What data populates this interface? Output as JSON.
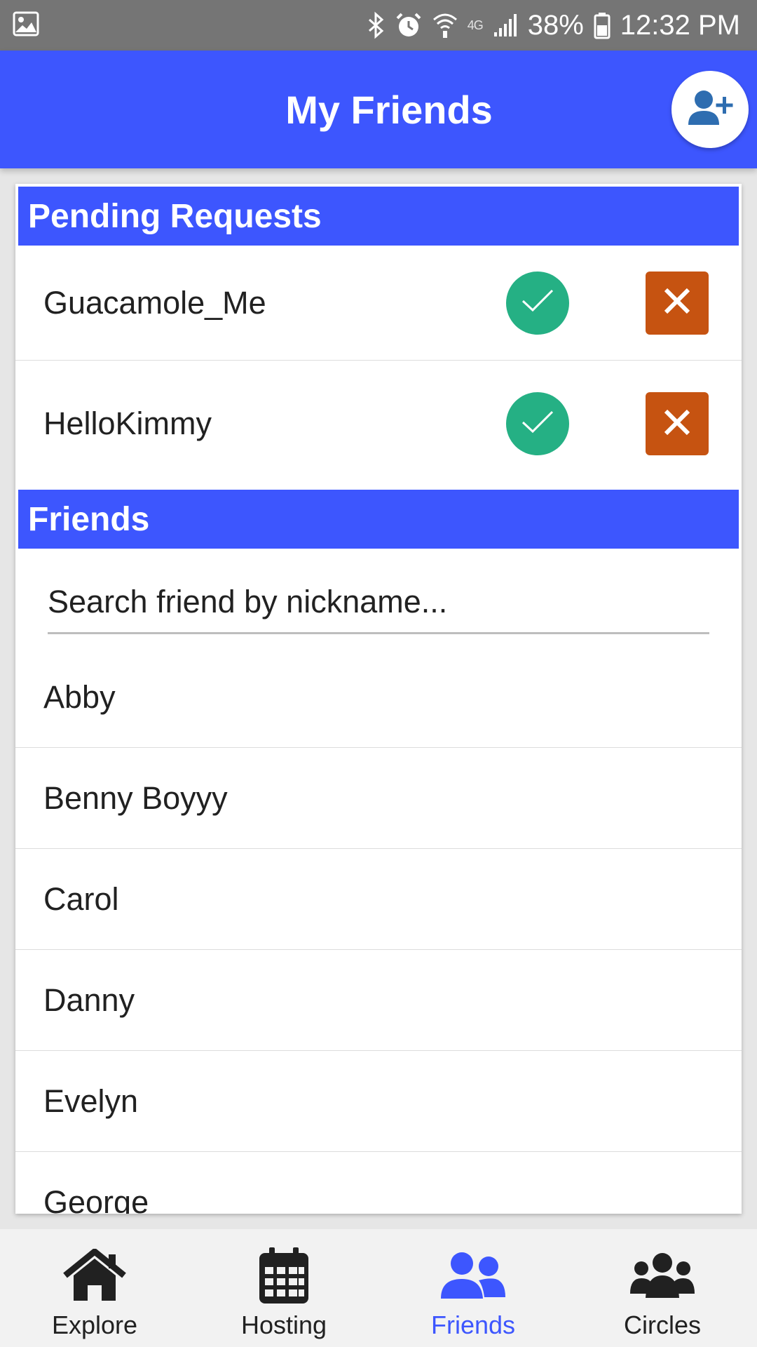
{
  "status_bar": {
    "battery": "38%",
    "time": "12:32 PM",
    "network": "4G"
  },
  "header": {
    "title": "My Friends",
    "add_friend_icon": "add-user-icon"
  },
  "pending": {
    "title": "Pending Requests",
    "requests": [
      {
        "name": "Guacamole_Me"
      },
      {
        "name": "HelloKimmy"
      }
    ]
  },
  "friends": {
    "title": "Friends",
    "search_placeholder": "Search friend by nickname...",
    "items": [
      {
        "name": "Abby"
      },
      {
        "name": "Benny Boyyy"
      },
      {
        "name": "Carol"
      },
      {
        "name": "Danny"
      },
      {
        "name": "Evelyn"
      },
      {
        "name": "George"
      }
    ]
  },
  "nav": {
    "items": [
      {
        "label": "Explore",
        "icon": "home-icon"
      },
      {
        "label": "Hosting",
        "icon": "calendar-icon"
      },
      {
        "label": "Friends",
        "icon": "friends-icon"
      },
      {
        "label": "Circles",
        "icon": "circles-icon"
      }
    ],
    "active": "Friends"
  },
  "colors": {
    "primary": "#3d56fe",
    "accept": "#25b084",
    "reject": "#c65311",
    "status_bar": "#757575",
    "nav_bg": "#f2f2f2"
  }
}
